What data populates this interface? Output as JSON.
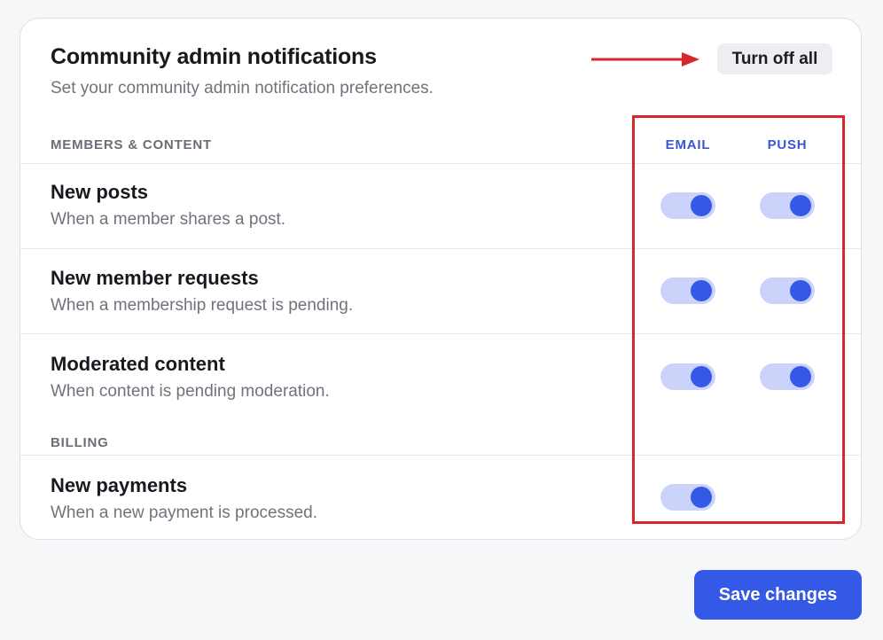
{
  "card": {
    "title": "Community admin notifications",
    "subtitle": "Set your community admin notification preferences.",
    "turn_off_all_label": "Turn off all"
  },
  "columns": {
    "email": "EMAIL",
    "push": "PUSH"
  },
  "sections": [
    {
      "label": "MEMBERS & CONTENT",
      "rows": [
        {
          "title": "New posts",
          "description": "When a member shares a post.",
          "email": true,
          "push": true
        },
        {
          "title": "New member requests",
          "description": "When a membership request is pending.",
          "email": true,
          "push": true
        },
        {
          "title": "Moderated content",
          "description": "When content is pending moderation.",
          "email": true,
          "push": true
        }
      ]
    },
    {
      "label": "BILLING",
      "rows": [
        {
          "title": "New payments",
          "description": "When a new payment is processed.",
          "email": true
        }
      ]
    }
  ],
  "footer": {
    "save_label": "Save changes"
  },
  "colors": {
    "accent": "#3459e6",
    "toggle_track_on": "#cbd3fb",
    "annotation_red": "#d8262d"
  },
  "icons": {
    "annotation_arrow": "arrow-right-icon"
  }
}
